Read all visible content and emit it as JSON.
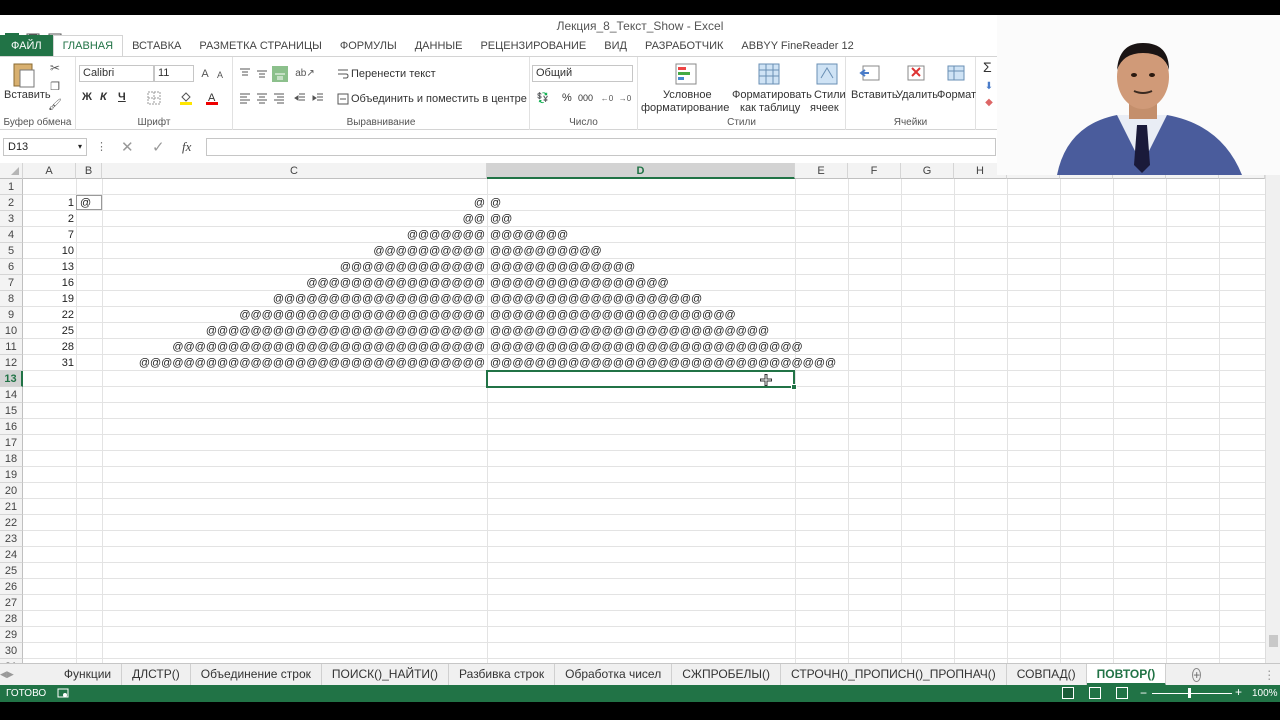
{
  "window": {
    "title": "Лекция_8_Текст_Show - Excel"
  },
  "ribbon_tabs": [
    "ФАЙЛ",
    "ГЛАВНАЯ",
    "ВСТАВКА",
    "РАЗМЕТКА СТРАНИЦЫ",
    "ФОРМУЛЫ",
    "ДАННЫЕ",
    "РЕЦЕНЗИРОВАНИЕ",
    "ВИД",
    "РАЗРАБОТЧИК",
    "ABBYY FineReader 12"
  ],
  "ribbon": {
    "paste_label": "Вставить",
    "clipboard_group": "Буфер обмена",
    "font_name": "Calibri",
    "font_size": "11",
    "font_group": "Шрифт",
    "bold": "Ж",
    "italic": "К",
    "underline": "Ч",
    "wrap_text": "Перенести текст",
    "merge_center": "Объединить и поместить в центре",
    "alignment_group": "Выравнивание",
    "number_format": "Общий",
    "percent": "%",
    "thousands": "000",
    "number_group": "Число",
    "conditional_1": "Условное",
    "conditional_2": "форматирование",
    "format_table_1": "Форматировать",
    "format_table_2": "как таблицу",
    "cell_styles_1": "Стили",
    "cell_styles_2": "ячеек",
    "styles_group": "Стили",
    "insert": "Вставить",
    "delete": "Удалить",
    "format": "Формат",
    "cells_group": "Ячейки",
    "sigma": "Σ"
  },
  "formula_bar": {
    "name_box": "D13",
    "fx": "fx",
    "formula": ""
  },
  "columns": [
    "A",
    "B",
    "C",
    "D",
    "E",
    "F",
    "G",
    "H"
  ],
  "selected_column": "D",
  "selected_row": 13,
  "rows": [
    {
      "r": 1,
      "a": "",
      "b": "",
      "c": "",
      "d": ""
    },
    {
      "r": 2,
      "a": "1",
      "b": "@",
      "c": "@",
      "d": "@"
    },
    {
      "r": 3,
      "a": "2",
      "b": "",
      "c": "@@",
      "d": "@@"
    },
    {
      "r": 4,
      "a": "7",
      "b": "",
      "c": "@@@@@@@",
      "d": "@@@@@@@"
    },
    {
      "r": 5,
      "a": "10",
      "b": "",
      "c": "@@@@@@@@@@",
      "d": "@@@@@@@@@@"
    },
    {
      "r": 6,
      "a": "13",
      "b": "",
      "c": "@@@@@@@@@@@@@",
      "d": "@@@@@@@@@@@@@"
    },
    {
      "r": 7,
      "a": "16",
      "b": "",
      "c": "@@@@@@@@@@@@@@@@",
      "d": "@@@@@@@@@@@@@@@@"
    },
    {
      "r": 8,
      "a": "19",
      "b": "",
      "c": "@@@@@@@@@@@@@@@@@@@",
      "d": "@@@@@@@@@@@@@@@@@@@"
    },
    {
      "r": 9,
      "a": "22",
      "b": "",
      "c": "@@@@@@@@@@@@@@@@@@@@@@",
      "d": "@@@@@@@@@@@@@@@@@@@@@@"
    },
    {
      "r": 10,
      "a": "25",
      "b": "",
      "c": "@@@@@@@@@@@@@@@@@@@@@@@@@",
      "d": "@@@@@@@@@@@@@@@@@@@@@@@@@"
    },
    {
      "r": 11,
      "a": "28",
      "b": "",
      "c": "@@@@@@@@@@@@@@@@@@@@@@@@@@@@",
      "d": "@@@@@@@@@@@@@@@@@@@@@@@@@@@@"
    },
    {
      "r": 12,
      "a": "31",
      "b": "",
      "c": "@@@@@@@@@@@@@@@@@@@@@@@@@@@@@@@",
      "d": "@@@@@@@@@@@@@@@@@@@@@@@@@@@@@@@"
    }
  ],
  "empty_rows": [
    13,
    14,
    15,
    16,
    17,
    18,
    19,
    20,
    21,
    22,
    23,
    24,
    25,
    26,
    27,
    28,
    29,
    30,
    31
  ],
  "sheet_tabs": [
    "Функции",
    "ДЛСТР()",
    "Объединение строк",
    "ПОИСК()_НАЙТИ()",
    "Разбивка строк",
    "Обработка чисел",
    "СЖПРОБЕЛЫ()",
    "СТРОЧН()_ПРОПИСН()_ПРОПНАЧ()",
    "СОВПАД()",
    "ПОВТОР()"
  ],
  "active_sheet": "ПОВТОР()",
  "status": {
    "ready": "ГОТОВО",
    "zoom": "100%"
  },
  "colors": {
    "accent": "#217346"
  }
}
